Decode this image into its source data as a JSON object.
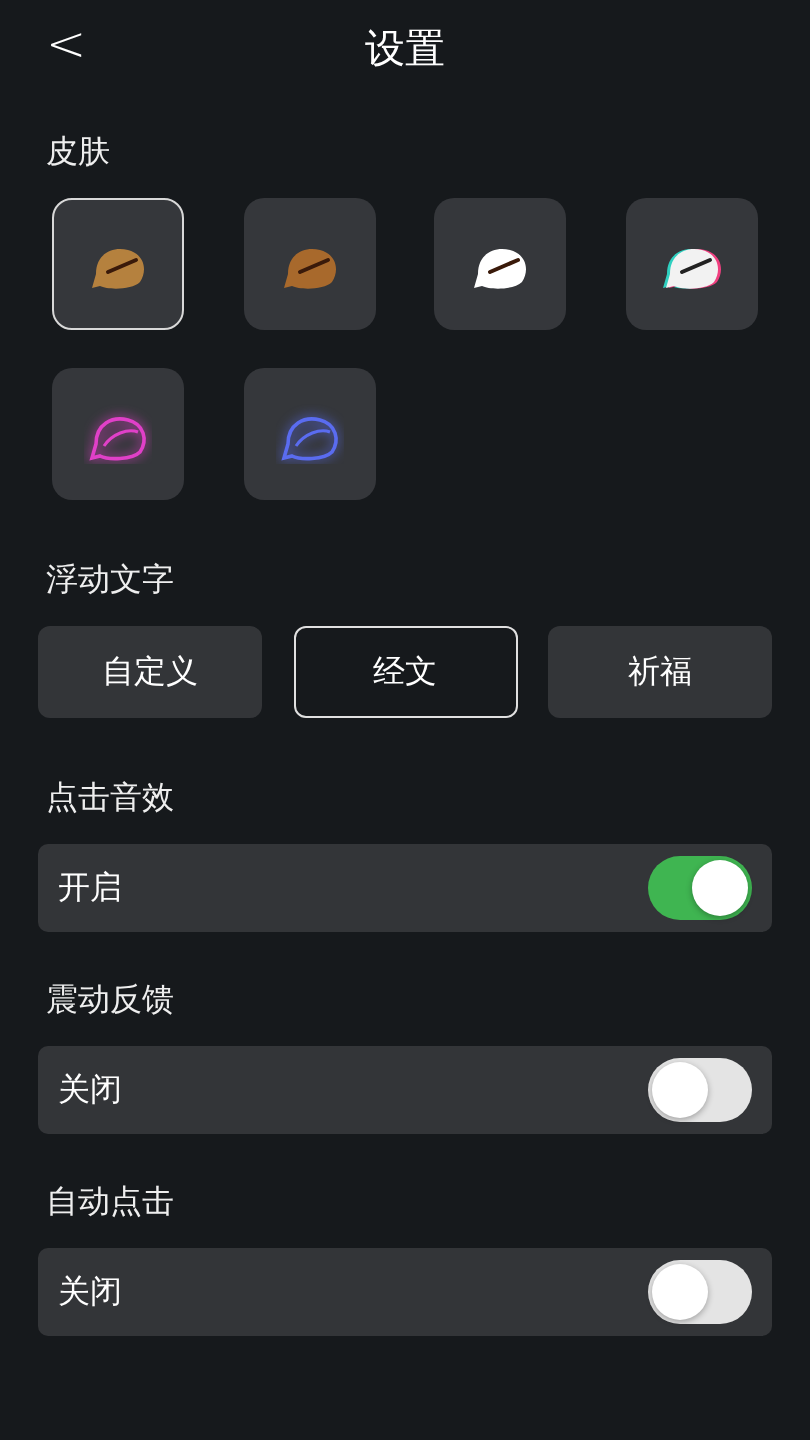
{
  "header": {
    "back": "<",
    "title": "设置"
  },
  "skins": {
    "label": "皮肤",
    "items": [
      {
        "kind": "solid",
        "color": "#b5813e",
        "selected": true
      },
      {
        "kind": "solid",
        "color": "#a8692c",
        "selected": false
      },
      {
        "kind": "solid",
        "color": "#ffffff",
        "selected": false
      },
      {
        "kind": "glitch",
        "color": "#f2f2f2",
        "selected": false
      },
      {
        "kind": "neon",
        "color": "#e040c8",
        "selected": false
      },
      {
        "kind": "neon",
        "color": "#5a6cf0",
        "selected": false
      }
    ]
  },
  "floating_text": {
    "label": "浮动文字",
    "options": [
      {
        "label": "自定义",
        "selected": false
      },
      {
        "label": "经文",
        "selected": true
      },
      {
        "label": "祈福",
        "selected": false
      }
    ]
  },
  "settings": [
    {
      "label": "点击音效",
      "value": "开启",
      "on": true
    },
    {
      "label": "震动反馈",
      "value": "关闭",
      "on": false
    },
    {
      "label": "自动点击",
      "value": "关闭",
      "on": false
    }
  ]
}
